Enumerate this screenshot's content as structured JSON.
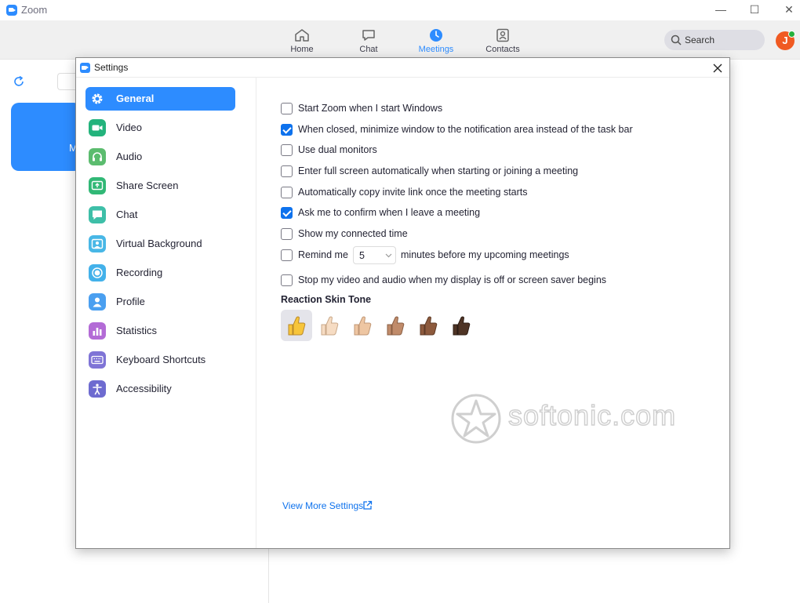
{
  "app": {
    "title": "Zoom"
  },
  "window_controls": {
    "minimize": "—",
    "maximize": "☐",
    "close": "✕"
  },
  "nav": [
    {
      "label": "Home",
      "icon": "home-icon"
    },
    {
      "label": "Chat",
      "icon": "chat-icon"
    },
    {
      "label": "Meetings",
      "icon": "clock-icon",
      "active": true
    },
    {
      "label": "Contacts",
      "icon": "contacts-icon"
    }
  ],
  "search": {
    "placeholder": "Search"
  },
  "user": {
    "initial": "J"
  },
  "background": {
    "card_letter": "M"
  },
  "dialog": {
    "title": "Settings"
  },
  "sidebar": {
    "items": [
      {
        "label": "General",
        "icon": "gear-icon",
        "active": true
      },
      {
        "label": "Video",
        "icon": "video-icon",
        "color": "#23b37c"
      },
      {
        "label": "Audio",
        "icon": "headphones-icon",
        "color": "#5bbc6e"
      },
      {
        "label": "Share Screen",
        "icon": "share-screen-icon",
        "color": "#31b876"
      },
      {
        "label": "Chat",
        "icon": "chat-bubble-icon",
        "color": "#3ebfa8"
      },
      {
        "label": "Virtual Background",
        "icon": "person-frame-icon",
        "color": "#48b7e6"
      },
      {
        "label": "Recording",
        "icon": "record-icon",
        "color": "#43b1ea"
      },
      {
        "label": "Profile",
        "icon": "profile-icon",
        "color": "#4a9ff0"
      },
      {
        "label": "Statistics",
        "icon": "bar-chart-icon",
        "color": "#b36bd6"
      },
      {
        "label": "Keyboard Shortcuts",
        "icon": "keyboard-icon",
        "color": "#7f74d6"
      },
      {
        "label": "Accessibility",
        "icon": "accessibility-icon",
        "color": "#6e6bd0"
      }
    ]
  },
  "general": {
    "options": [
      {
        "label": "Start Zoom when I start Windows",
        "checked": false
      },
      {
        "label": "When closed, minimize window to the notification area instead of the task bar",
        "checked": true
      },
      {
        "label": "Use dual monitors",
        "checked": false
      },
      {
        "label": "Enter full screen automatically when starting or joining a meeting",
        "checked": false
      },
      {
        "label": "Automatically copy invite link once the meeting starts",
        "checked": false
      },
      {
        "label": "Ask me to confirm when I leave a meeting",
        "checked": true
      },
      {
        "label": "Show my connected time",
        "checked": false
      }
    ],
    "remind": {
      "label": "Remind me",
      "value": "5",
      "suffix": "minutes before my upcoming meetings",
      "checked": false
    },
    "stop_video": {
      "label": "Stop my video and audio when my display is off or screen saver begins",
      "checked": false
    },
    "skin_tone": {
      "title": "Reaction Skin Tone",
      "tones": [
        "#f7c53a",
        "#f6dcc3",
        "#eec6a2",
        "#c08b6a",
        "#8d5a3d",
        "#4f3425"
      ],
      "selected": 0
    },
    "more_link": "View More Settings"
  },
  "watermark": {
    "text": "softonic.com"
  }
}
